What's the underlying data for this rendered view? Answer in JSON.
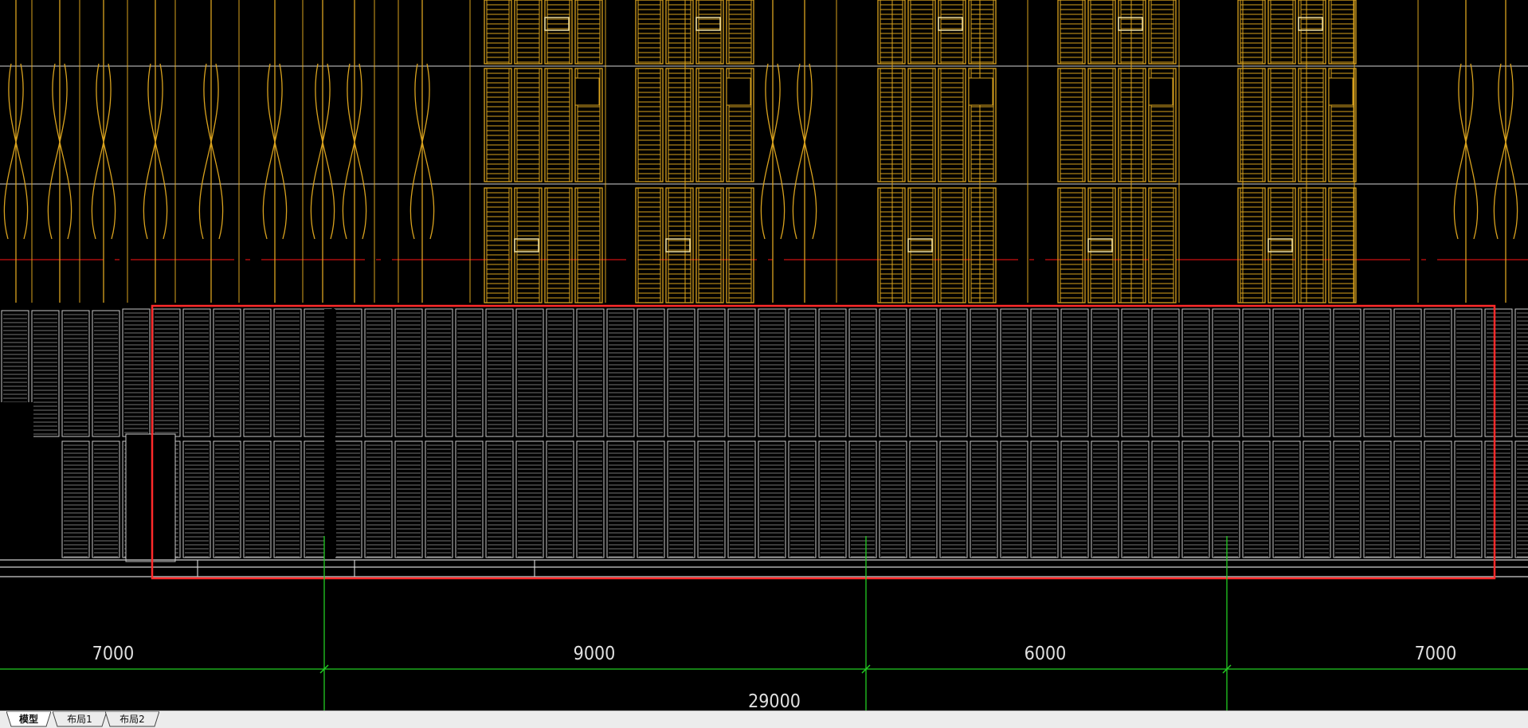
{
  "drawing": {
    "dimensions": {
      "bays": [
        "7000",
        "9000",
        "6000",
        "7000"
      ],
      "total": "29000"
    },
    "colors": {
      "background": "#000000",
      "facade_lines": "#d9a21e",
      "lower_panels": "#c8c8c8",
      "selection_box": "#ff2a2a",
      "dimension_lines": "#22cc22",
      "axis_line": "#cc1111"
    }
  },
  "tabs": [
    {
      "label": "模型",
      "active": true
    },
    {
      "label": "布局1",
      "active": false
    },
    {
      "label": "布局2",
      "active": false
    }
  ]
}
